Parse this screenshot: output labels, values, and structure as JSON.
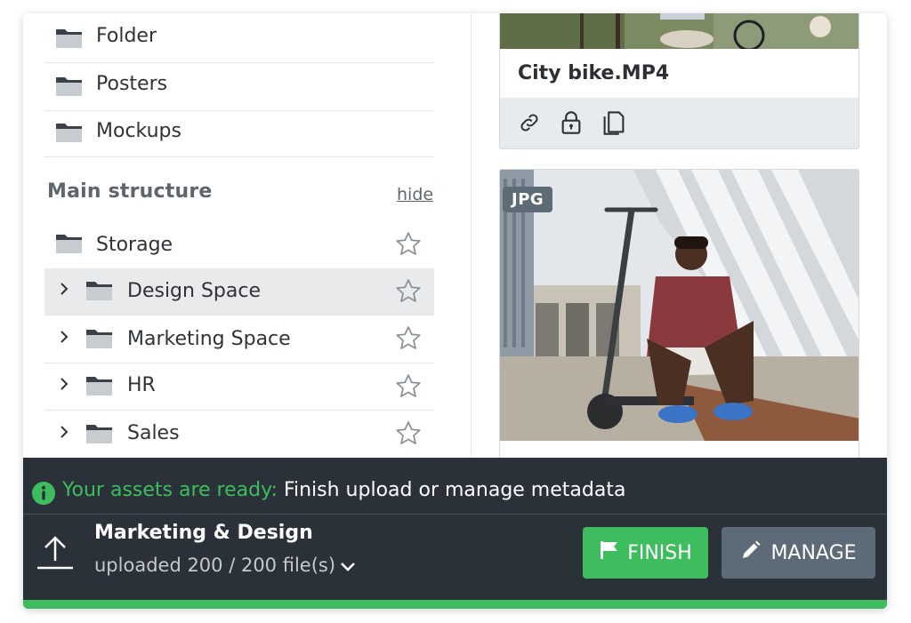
{
  "sidebar": {
    "top_items": [
      {
        "label": "Folder"
      },
      {
        "label": "Posters"
      },
      {
        "label": "Mockups"
      }
    ],
    "section_title": "Main structure",
    "hide_label": "hide",
    "structure_items": [
      {
        "label": "Storage",
        "expandable": false,
        "selected": false
      },
      {
        "label": "Design Space",
        "expandable": true,
        "selected": true
      },
      {
        "label": "Marketing Space",
        "expandable": true,
        "selected": false
      },
      {
        "label": "HR",
        "expandable": true,
        "selected": false
      },
      {
        "label": "Sales",
        "expandable": true,
        "selected": false
      }
    ]
  },
  "assets": {
    "video_card": {
      "name": "City bike.MP4",
      "actions": [
        "link-icon",
        "lock-icon",
        "copy-icon"
      ]
    },
    "image_card": {
      "badge": "JPG"
    }
  },
  "notification": {
    "ready_highlight": "Your assets are ready:",
    "ready_rest": "Finish upload or manage metadata",
    "job_title": "Marketing & Design",
    "job_status": "uploaded 200 / 200 file(s)",
    "finish_label": "FINISH",
    "manage_label": "MANAGE",
    "progress": 1.0
  },
  "colors": {
    "accent_green": "#3dbd5d",
    "panel_dark": "#2a3139",
    "manage_gray": "#5d6b78",
    "badge_gray": "#5d6b77"
  }
}
